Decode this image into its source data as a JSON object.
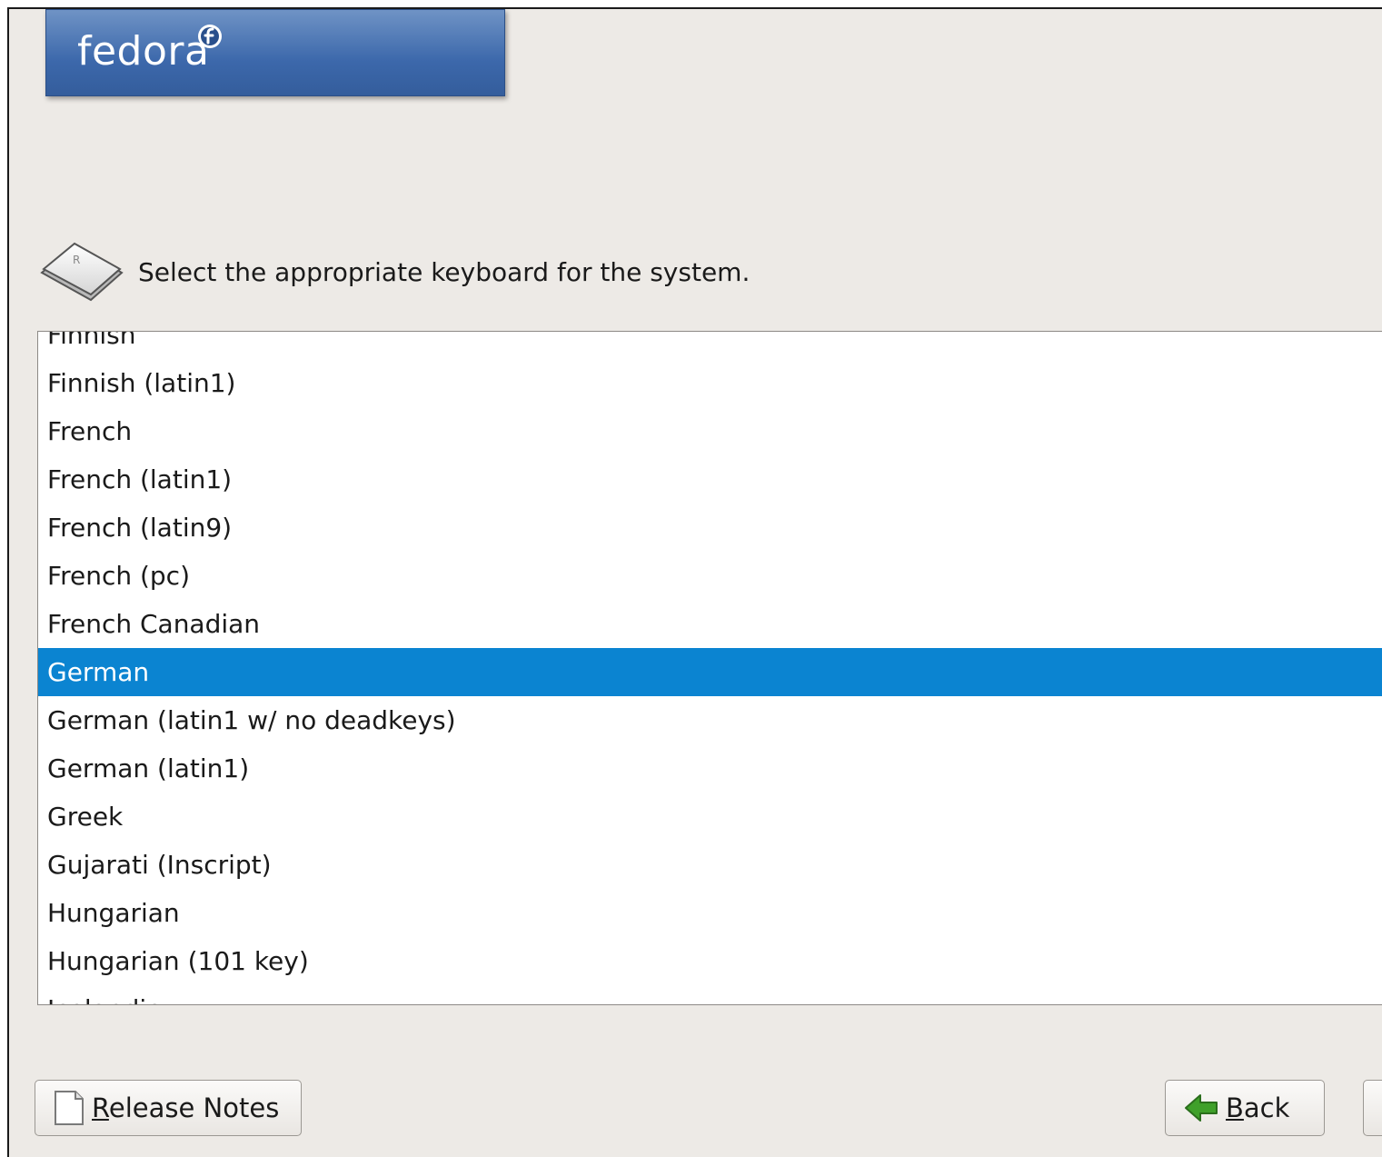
{
  "header": {
    "logo_text": "fedora"
  },
  "prompt": {
    "text": "Select the appropriate keyboard for the system."
  },
  "keyboard_list": {
    "items": [
      "Finnish",
      "Finnish (latin1)",
      "French",
      "French (latin1)",
      "French (latin9)",
      "French (pc)",
      "French Canadian",
      "German",
      "German (latin1 w/ no deadkeys)",
      "German (latin1)",
      "Greek",
      "Gujarati (Inscript)",
      "Hungarian",
      "Hungarian (101 key)",
      "Icelandic"
    ],
    "selected": "German",
    "selected_color": "#0b84d1"
  },
  "buttons": {
    "release_notes": {
      "mnemonic": "R",
      "rest": "elease Notes",
      "icon": "document-icon"
    },
    "back": {
      "mnemonic": "B",
      "rest": "ack",
      "icon": "back-arrow-icon"
    }
  },
  "colors": {
    "window_bg": "#edeae6",
    "banner_blue": "#3c68ab",
    "back_arrow_green": "#3fa02a"
  }
}
